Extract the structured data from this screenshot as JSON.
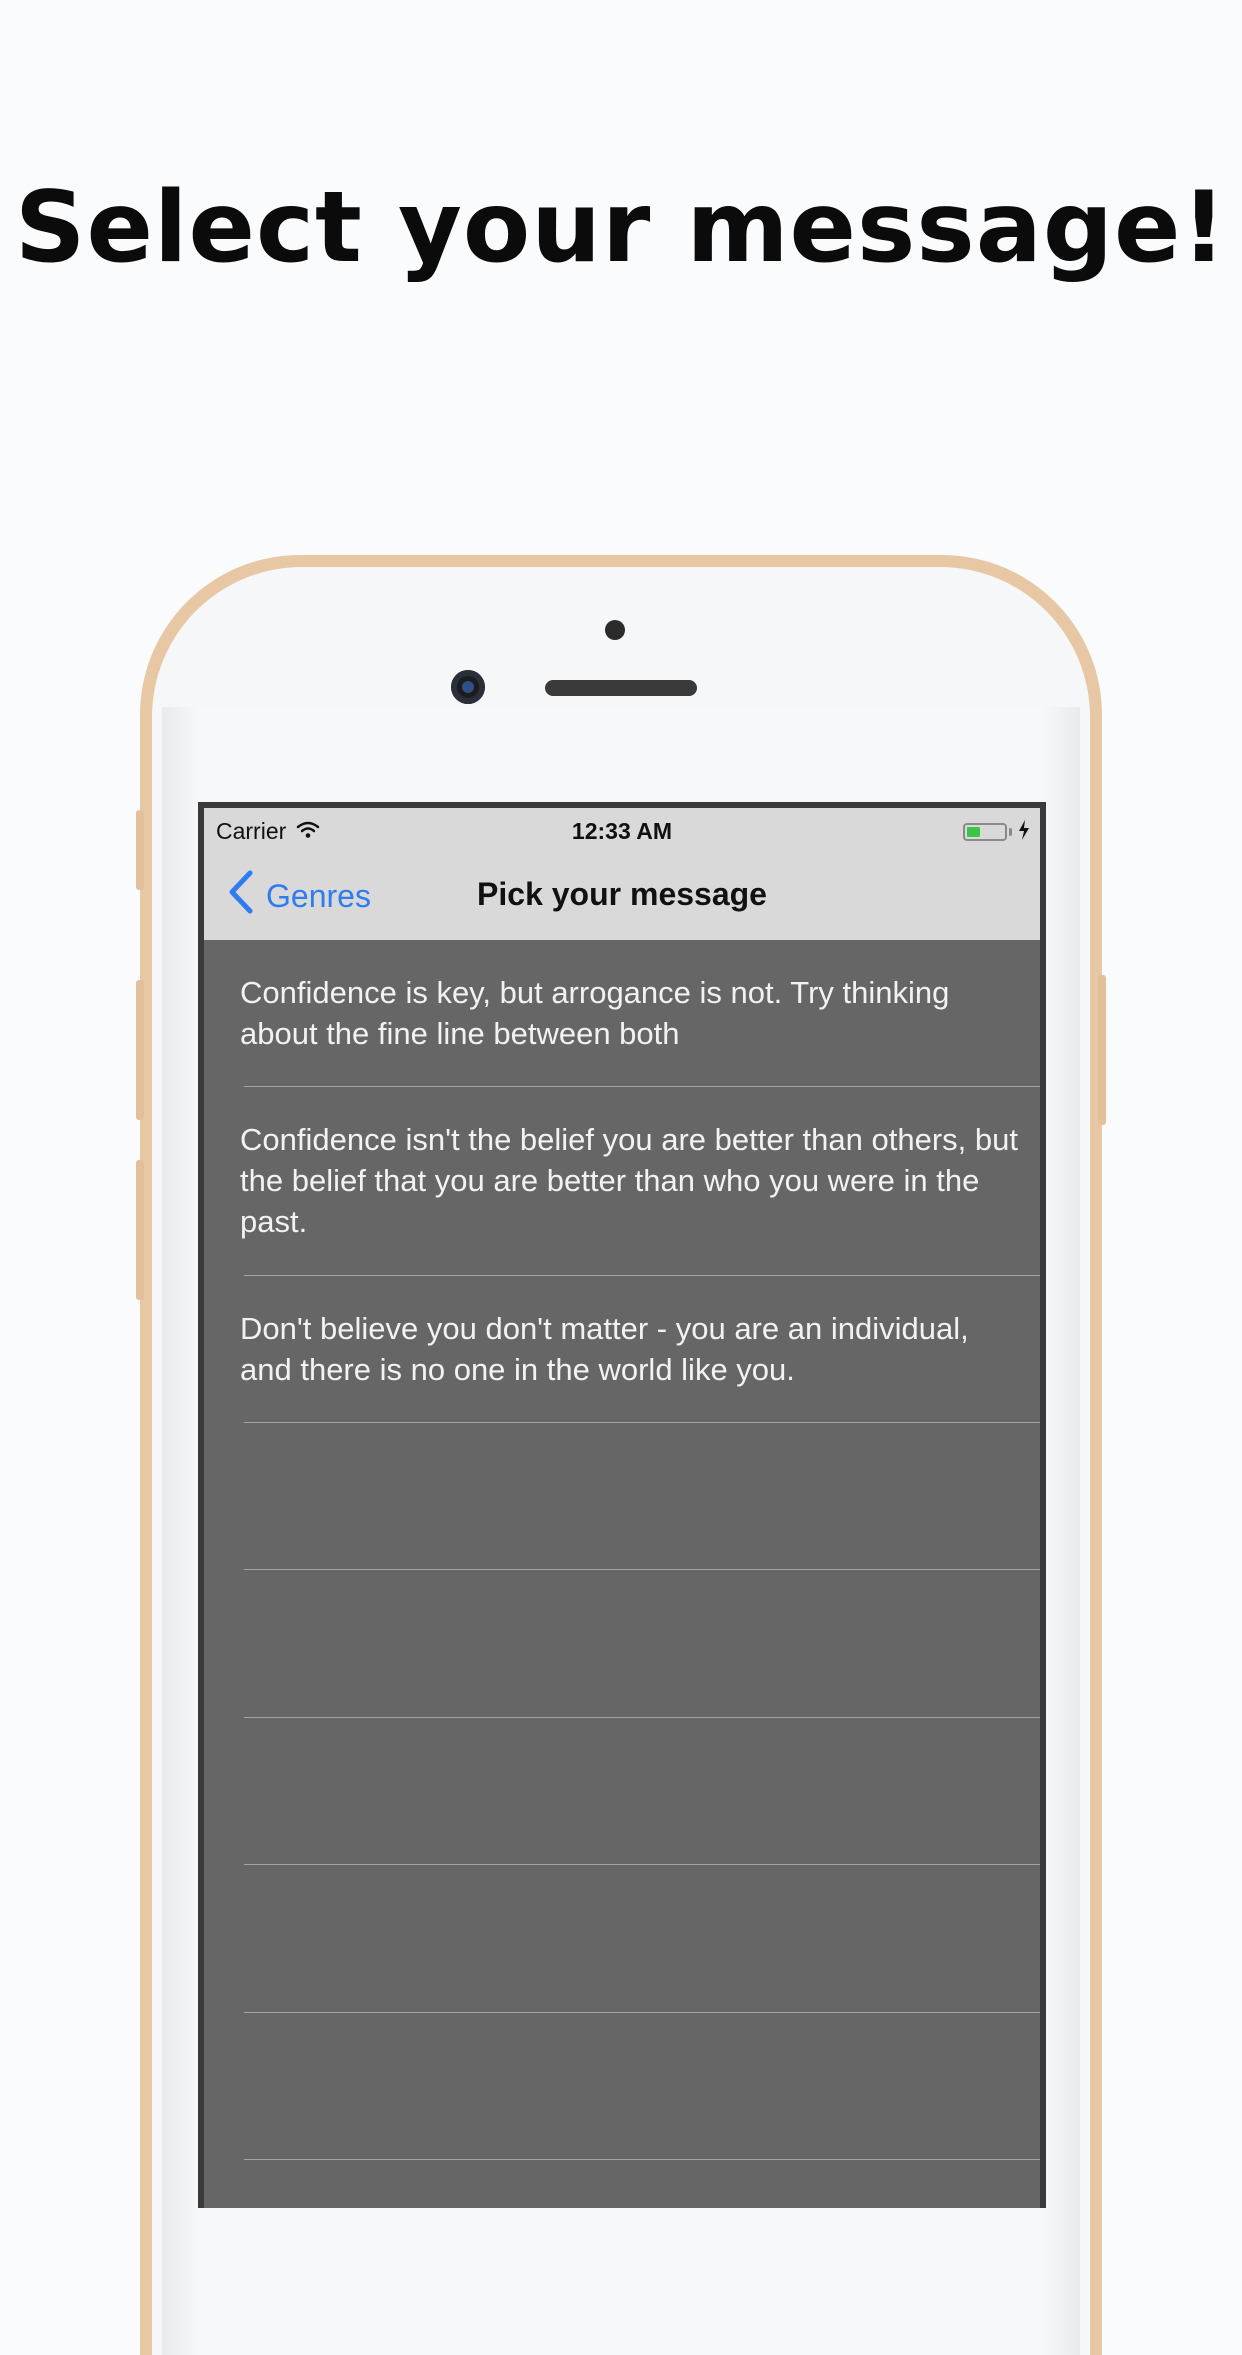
{
  "headline": "Select your message!",
  "status_bar": {
    "carrier": "Carrier",
    "time": "12:33 AM",
    "battery_level": 0.35
  },
  "nav_bar": {
    "back_label": "Genres",
    "title": "Pick your message"
  },
  "messages": [
    "Confidence is key, but arrogance is not. Try thinking about the fine line between both",
    "Confidence isn't the belief you are better than others, but the belief that you are better than who you were in the past.",
    "Don't believe you don't matter - you are an individual, and there is no one in the world like you.",
    "",
    "",
    "",
    "",
    "",
    ""
  ],
  "colors": {
    "back_accent": "#2f7cf0",
    "bar_background": "#d9d9d9",
    "list_background": "#666666",
    "phone_frame": "#e8c7a4"
  },
  "icons": [
    "chevron-left-icon",
    "wifi-icon",
    "battery-icon",
    "charging-bolt-icon"
  ]
}
